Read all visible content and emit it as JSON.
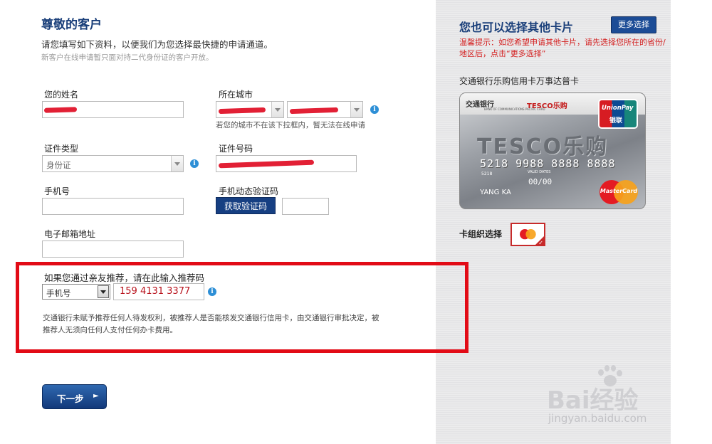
{
  "form": {
    "title": "尊敬的客户",
    "intro": "请您填写如下资料，以便我们为您选择最快捷的申请通道。",
    "subnote": "新客户在线申请暂只面对持二代身份证的客户开放。",
    "name_label": "您的姓名",
    "city_label": "所在城市",
    "city_hint": "若您的城市不在该下拉框内，暂无法在线申请",
    "id_type_label": "证件类型",
    "id_type_value": "身份证",
    "id_number_label": "证件号码",
    "mobile_label": "手机号",
    "sms_code_label": "手机动态验证码",
    "get_code_button": "获取验证码",
    "email_label": "电子邮箱地址",
    "next_button": "下一步",
    "next_chevron": "►"
  },
  "referral": {
    "prompt": "如果您通过亲友推荐，请在此输入推荐码",
    "type_value": "手机号",
    "code_value": "159 4131 3377",
    "disclaimer": "交通银行未赋予推荐任何人待发权利，被推荐人是否能核发交通银行信用卡，由交通银行审批决定，被推荐人无须向任何人支付任何办卡费用。"
  },
  "sidebar": {
    "title": "您也可以选择其他卡片",
    "more_button": "更多选择",
    "tip": "温馨提示：如您希望申请其他卡片，请先选择您所在的省份/地区后，点击“更多选择”",
    "card_name": "交通银行乐购信用卡万事达普卡",
    "org_label": "卡组织选择"
  },
  "card": {
    "bank_name": "交通银行",
    "bank_en": "BANK OF COMMUNICATIONS  PACIFIC CARD",
    "brand_small": "TESCO乐购",
    "brand_big": "TESCO乐购",
    "number": "5218 9988 8888 8888",
    "bin": "5218",
    "valid_label": "VALID DATES",
    "expiry": "00/00",
    "holder": "YANG KA",
    "unionpay_text": "UnionPay",
    "unionpay_cn": "银联",
    "mastercard_text": "MasterCard"
  },
  "info_icon_glyph": "i",
  "watermark": {
    "text": "Bai经验",
    "url": "jingyan.baidu.com"
  },
  "colors": {
    "accent": "#1a3f7a",
    "highlight_border": "#e20b16",
    "tip_red": "#d42020"
  }
}
